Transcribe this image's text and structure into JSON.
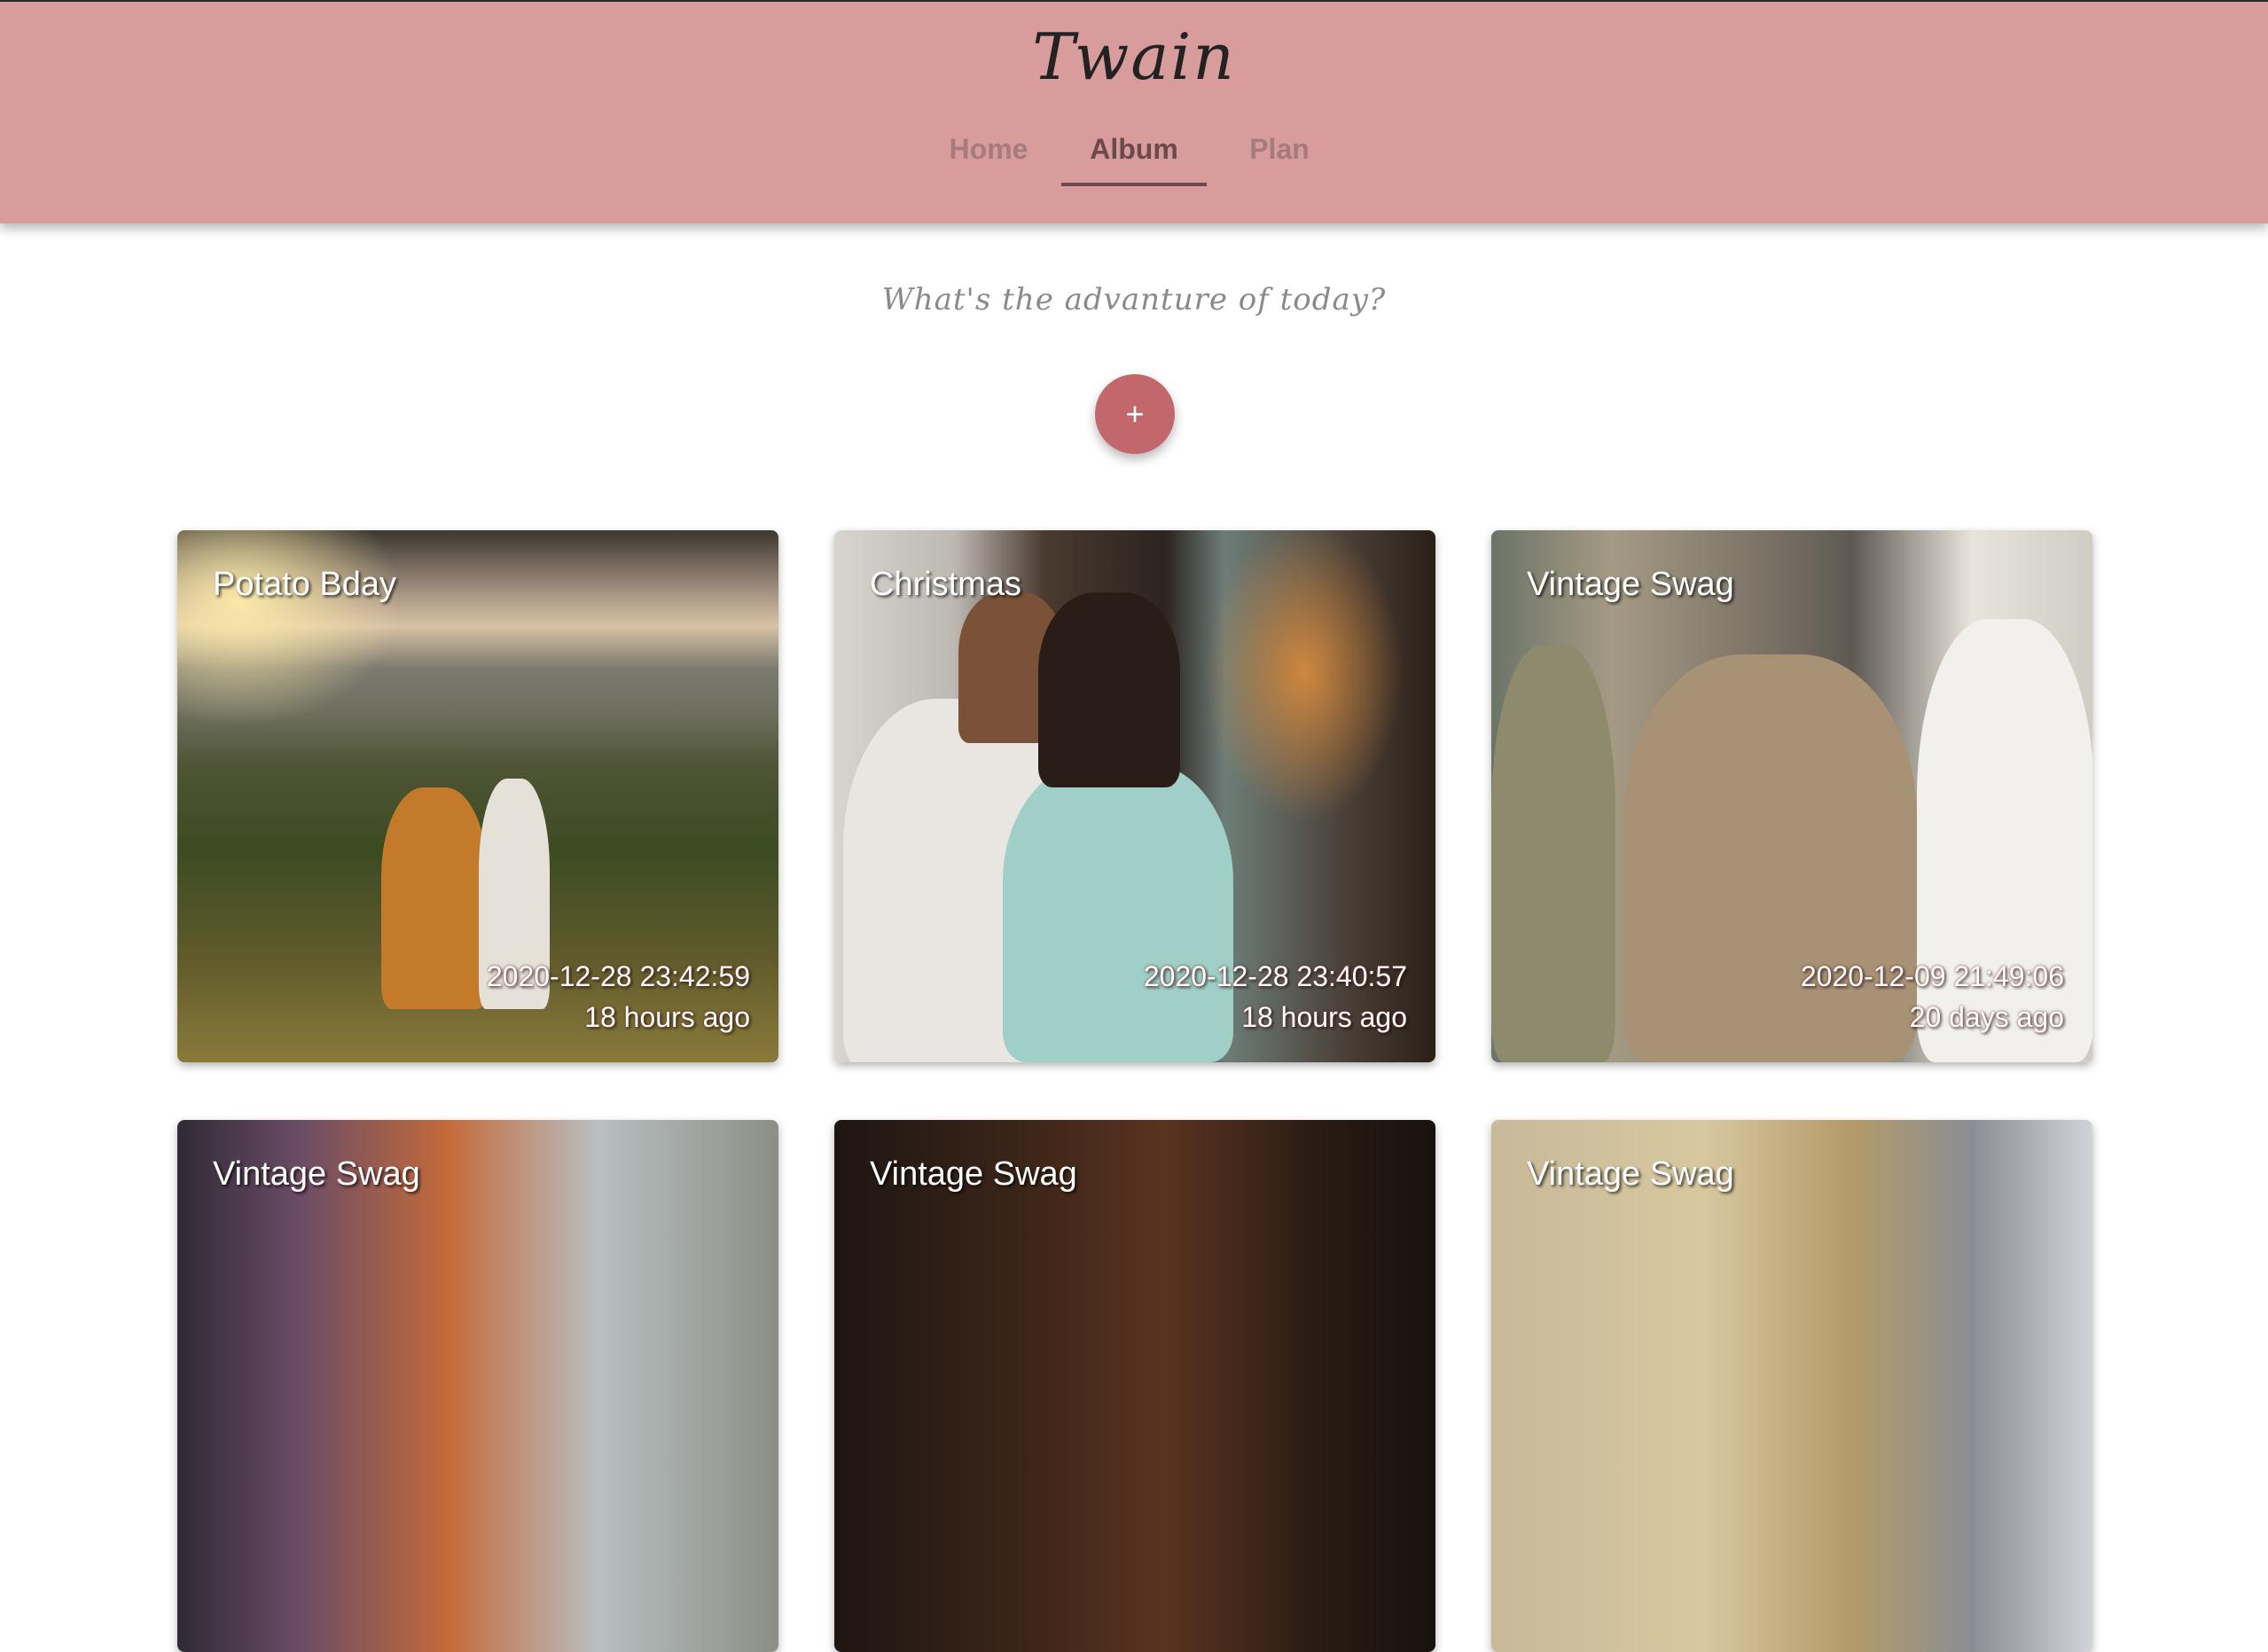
{
  "app": {
    "brand": "Twain"
  },
  "nav": {
    "tabs": [
      {
        "label": "Home",
        "active": false
      },
      {
        "label": "Album",
        "active": true
      },
      {
        "label": "Plan",
        "active": false
      }
    ]
  },
  "main": {
    "prompt": "What's the advanture of today?",
    "add_label": "+"
  },
  "colors": {
    "header_bg": "#d99c9d",
    "accent": "#c2686c",
    "active_tab": "#6a4a4b"
  },
  "albums": [
    {
      "title": "Potato Bday",
      "date": "2020-12-28 23:42:59",
      "ago": "18 hours ago"
    },
    {
      "title": "Christmas",
      "date": "2020-12-28 23:40:57",
      "ago": "18 hours ago"
    },
    {
      "title": "Vintage Swag",
      "date": "2020-12-09 21:49:06",
      "ago": "20 days ago"
    },
    {
      "title": "Vintage Swag"
    },
    {
      "title": "Vintage Swag"
    },
    {
      "title": "Vintage Swag"
    }
  ]
}
